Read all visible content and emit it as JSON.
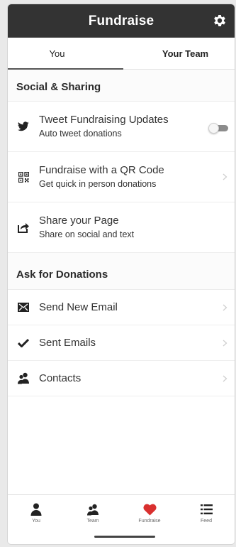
{
  "header": {
    "title": "Fundraise",
    "settings_icon": "gear-icon"
  },
  "tabs": [
    {
      "label": "You",
      "active": true
    },
    {
      "label": "Your Team",
      "active": false
    }
  ],
  "sections": [
    {
      "title": "Social & Sharing",
      "items": [
        {
          "icon": "twitter-icon",
          "title": "Tweet Fundraising Updates",
          "subtitle": "Auto tweet donations",
          "control": "toggle",
          "toggle_on": false
        },
        {
          "icon": "qr-code-icon",
          "title": "Fundraise with a QR Code",
          "subtitle": "Get quick in person donations",
          "control": "chevron"
        },
        {
          "icon": "share-icon",
          "title": "Share your Page",
          "subtitle": "Share on social and text",
          "control": "none"
        }
      ]
    },
    {
      "title": "Ask for Donations",
      "items": [
        {
          "icon": "envelope-icon",
          "title": "Send New Email",
          "control": "chevron"
        },
        {
          "icon": "checkmark-icon",
          "title": "Sent Emails",
          "control": "chevron"
        },
        {
          "icon": "contacts-icon",
          "title": "Contacts",
          "control": "chevron"
        }
      ]
    }
  ],
  "tabbar": [
    {
      "icon": "person-icon",
      "label": "You"
    },
    {
      "icon": "team-icon",
      "label": "Team"
    },
    {
      "icon": "heart-icon",
      "label": "Fundraise",
      "active": true
    },
    {
      "icon": "feed-icon",
      "label": "Feed"
    }
  ],
  "colors": {
    "header_bg": "#333333",
    "accent_heart": "#d9302f",
    "text": "#333333"
  }
}
